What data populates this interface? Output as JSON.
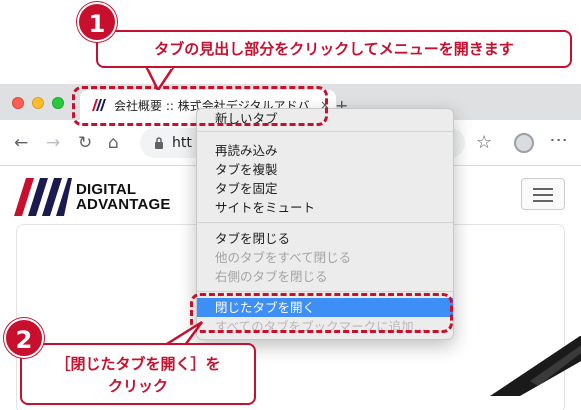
{
  "browser": {
    "tab_title": "会社概要 :: 株式会社デジタルアドバ",
    "tab_close": "×",
    "new_tab": "+",
    "url": "htt",
    "lock_icon": "lock-icon",
    "nav": {
      "back": "←",
      "forward": "→",
      "reload": "↻",
      "home": "⌂"
    },
    "star": "☆",
    "menu": "⋮"
  },
  "page": {
    "logo_line1": "DIGITAL",
    "logo_line2": "ADVANTAGE"
  },
  "context_menu": {
    "items": [
      {
        "label": "新しいタブ",
        "state": "normal"
      },
      {
        "label": "再読み込み",
        "state": "normal"
      },
      {
        "label": "タブを複製",
        "state": "normal"
      },
      {
        "label": "タブを固定",
        "state": "normal"
      },
      {
        "label": "サイトをミュート",
        "state": "normal"
      },
      {
        "label": "タブを閉じる",
        "state": "normal"
      },
      {
        "label": "他のタブをすべて閉じる",
        "state": "disabled"
      },
      {
        "label": "右側のタブを閉じる",
        "state": "disabled"
      },
      {
        "label": "閉じたタブを開く",
        "state": "highlighted"
      },
      {
        "label": "すべてのタブをブックマークに追加...",
        "state": "disabled"
      }
    ]
  },
  "annotations": {
    "step1_number": "1",
    "step1_text": "タブの見出し部分をクリックしてメニューを開きます",
    "step2_number": "2",
    "step2_line1": "［閉じたタブを開く］を",
    "step2_line2": "クリック"
  },
  "colors": {
    "annotation_red": "#c8102e",
    "menu_highlight": "#3d8ef5",
    "titlebar": "#dfe0e2"
  }
}
